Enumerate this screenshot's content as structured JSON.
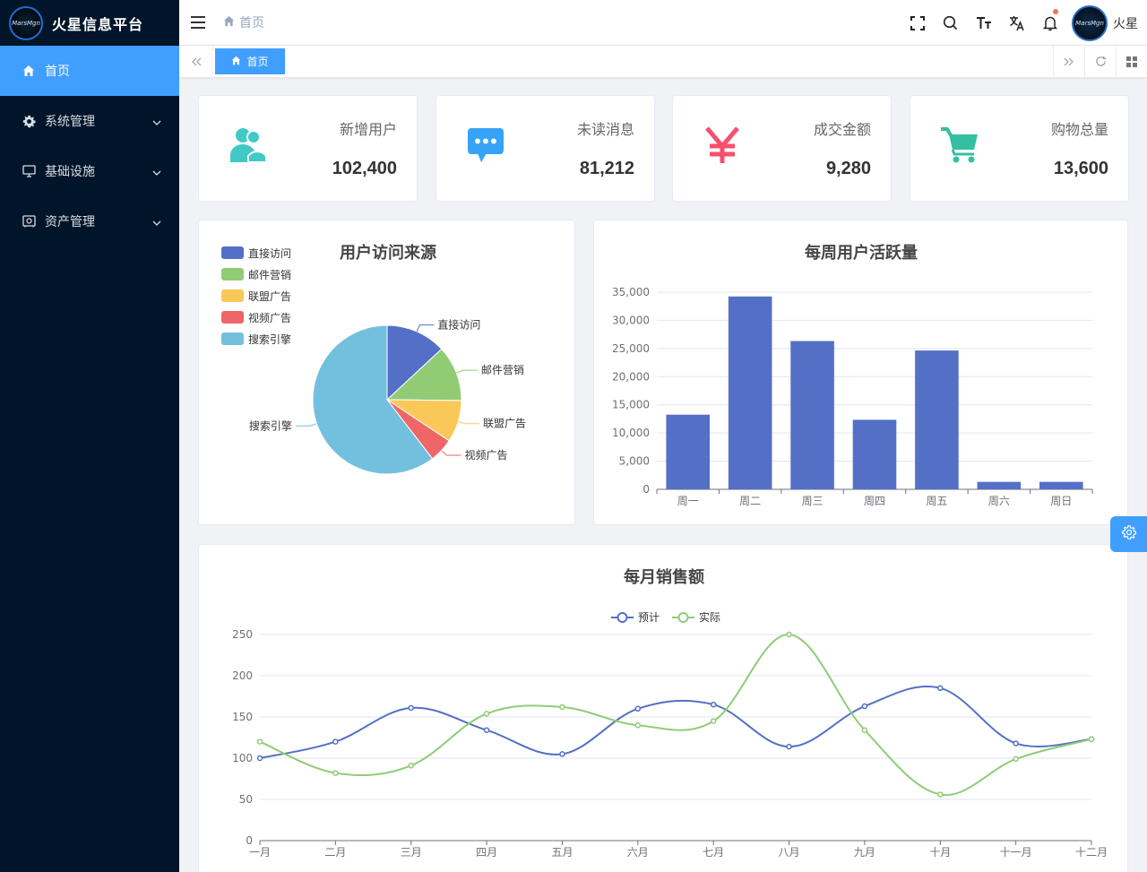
{
  "app": {
    "title": "火星信息平台",
    "logo_text": "MarsMgn"
  },
  "sidebar": {
    "items": [
      {
        "label": "首页",
        "icon": "home-icon",
        "active": true
      },
      {
        "label": "系统管理",
        "icon": "gear-icon",
        "expandable": true
      },
      {
        "label": "基础设施",
        "icon": "monitor-icon",
        "expandable": true
      },
      {
        "label": "资产管理",
        "icon": "asset-icon",
        "expandable": true
      }
    ]
  },
  "header": {
    "breadcrumb": "首页",
    "user_name": "火星",
    "icons": [
      "fullscreen-icon",
      "search-icon",
      "font-size-icon",
      "translate-icon",
      "bell-icon"
    ]
  },
  "tags": {
    "active_tag": "首页"
  },
  "stats": [
    {
      "label": "新增用户",
      "value": "102,400",
      "icon": "users-icon",
      "color": "#40c9c6"
    },
    {
      "label": "未读消息",
      "value": "81,212",
      "icon": "message-icon",
      "color": "#36a3f7"
    },
    {
      "label": "成交金额",
      "value": "9,280",
      "icon": "yen-icon",
      "color": "#f4516c"
    },
    {
      "label": "购物总量",
      "value": "13,600",
      "icon": "cart-icon",
      "color": "#34bfa3"
    }
  ],
  "chart_data": [
    {
      "type": "pie",
      "title": "用户访问来源",
      "legend_placement": "top-left",
      "categories": [
        "直接访问",
        "邮件营销",
        "联盟广告",
        "视频广告",
        "搜索引擎"
      ],
      "values": [
        335,
        310,
        234,
        135,
        1548
      ],
      "colors": [
        "#5470c6",
        "#91cc75",
        "#fac858",
        "#ee6666",
        "#73c0de"
      ]
    },
    {
      "type": "bar",
      "title": "每周用户活跃量",
      "categories": [
        "周一",
        "周二",
        "周三",
        "周四",
        "周五",
        "周六",
        "周日"
      ],
      "values": [
        13253,
        34235,
        26321,
        12340,
        24643,
        1322,
        1324
      ],
      "ylim": [
        0,
        35000
      ],
      "yticks": [
        "0",
        "5,000",
        "10,000",
        "15,000",
        "20,000",
        "25,000",
        "30,000",
        "35,000"
      ],
      "grid": true,
      "color": "#5470c6"
    },
    {
      "type": "line",
      "title": "每月销售额",
      "legend_placement": "top-center",
      "categories": [
        "一月",
        "二月",
        "三月",
        "四月",
        "五月",
        "六月",
        "七月",
        "八月",
        "九月",
        "十月",
        "十一月",
        "十二月"
      ],
      "series": [
        {
          "name": "预计",
          "values": [
            100,
            120,
            161,
            134,
            105,
            160,
            165,
            114,
            163,
            185,
            118,
            123
          ],
          "color": "#5470c6"
        },
        {
          "name": "实际",
          "values": [
            120,
            82,
            91,
            154,
            162,
            140,
            145,
            250,
            134,
            56,
            99,
            123
          ],
          "color": "#91cc75"
        }
      ],
      "ylim": [
        0,
        250
      ],
      "yticks": [
        "0",
        "50",
        "100",
        "150",
        "200",
        "250"
      ],
      "grid": true
    }
  ]
}
